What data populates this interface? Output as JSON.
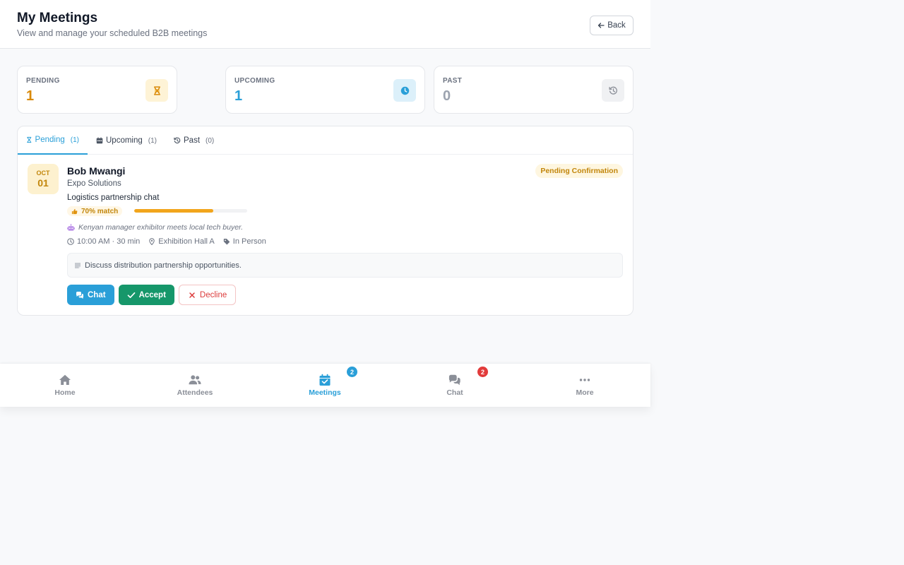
{
  "header": {
    "title": "My Meetings",
    "subtitle": "View and manage your scheduled B2B meetings",
    "back_label": "Back"
  },
  "stats": [
    {
      "label": "PENDING",
      "value": "1",
      "color": "#d98a0b",
      "icon_bg": "#fef3d6",
      "icon": "hourglass-icon"
    },
    {
      "label": "UPCOMING",
      "value": "1",
      "color": "#2a9fd8",
      "icon_bg": "#dcf0fa",
      "icon": "clock-icon"
    },
    {
      "label": "PAST",
      "value": "0",
      "color": "#9ca3af",
      "icon_bg": "#f0f1f3",
      "icon": "history-icon"
    }
  ],
  "tabs": [
    {
      "label": "Pending",
      "count": "(1)",
      "icon": "hourglass-icon",
      "active": true
    },
    {
      "label": "Upcoming",
      "count": "(1)",
      "icon": "calendar-icon",
      "active": false
    },
    {
      "label": "Past",
      "count": "(0)",
      "icon": "history-icon",
      "active": false
    }
  ],
  "meeting": {
    "month": "OCT",
    "day": "01",
    "name": "Bob Mwangi",
    "company": "Expo Solutions",
    "topic": "Logistics partnership chat",
    "status": "Pending Confirmation",
    "match_label": "70% match",
    "match_percent": 70,
    "ai_note": "Kenyan manager exhibitor meets local tech buyer.",
    "time": "10:00 AM · 30 min",
    "location": "Exhibition Hall A",
    "type": "In Person",
    "notes": "Discuss distribution partnership opportunities.",
    "actions": {
      "chat": "Chat",
      "accept": "Accept",
      "decline": "Decline"
    }
  },
  "nav": [
    {
      "label": "Home",
      "icon": "home-icon",
      "active": false,
      "badge": ""
    },
    {
      "label": "Attendees",
      "icon": "users-icon",
      "active": false,
      "badge": ""
    },
    {
      "label": "Meetings",
      "icon": "calendar-check-icon",
      "active": true,
      "badge": "2",
      "badge_color": "#2a9fd8"
    },
    {
      "label": "Chat",
      "icon": "chat-icon",
      "active": false,
      "badge": "2",
      "badge_color": "#e23b3b"
    },
    {
      "label": "More",
      "icon": "ellipsis-icon",
      "active": false,
      "badge": ""
    }
  ]
}
